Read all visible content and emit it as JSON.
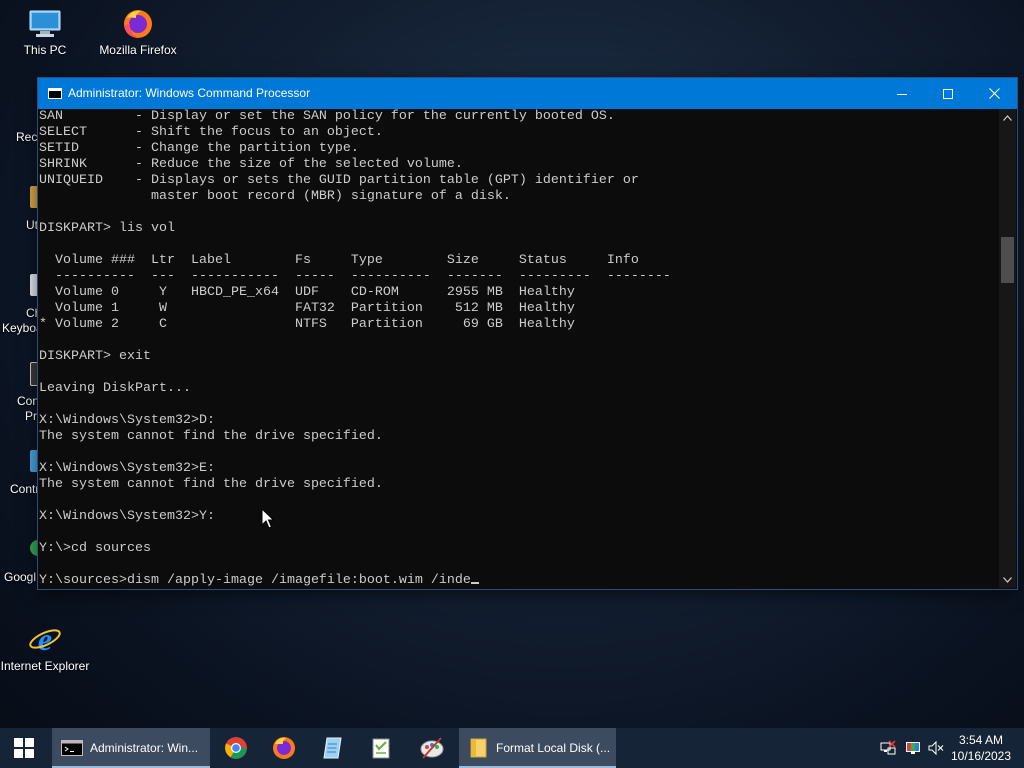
{
  "desktop": {
    "icons": [
      {
        "label": "This PC"
      },
      {
        "label": "Mozilla Firefox"
      },
      {
        "label": "Internet Explorer"
      }
    ],
    "partial_labels": [
      "Recy",
      "Ut",
      "Ch",
      "Keyboa",
      "Con",
      "Pr",
      "Contr",
      "Googl"
    ]
  },
  "window": {
    "title": "Administrator: Windows Command Processor",
    "console_lines": [
      "SAN         - Display or set the SAN policy for the currently booted OS.",
      "SELECT      - Shift the focus to an object.",
      "SETID       - Change the partition type.",
      "SHRINK      - Reduce the size of the selected volume.",
      "UNIQUEID    - Displays or sets the GUID partition table (GPT) identifier or",
      "              master boot record (MBR) signature of a disk.",
      "",
      "DISKPART> lis vol",
      "",
      "  Volume ###  Ltr  Label        Fs     Type        Size     Status     Info",
      "  ----------  ---  -----------  -----  ----------  -------  ---------  --------",
      "  Volume 0     Y   HBCD_PE_x64  UDF    CD-ROM      2955 MB  Healthy",
      "  Volume 1     W                FAT32  Partition    512 MB  Healthy",
      "* Volume 2     C                NTFS   Partition     69 GB  Healthy",
      "",
      "DISKPART> exit",
      "",
      "Leaving DiskPart...",
      "",
      "X:\\Windows\\System32>D:",
      "The system cannot find the drive specified.",
      "",
      "X:\\Windows\\System32>E:",
      "The system cannot find the drive specified.",
      "",
      "X:\\Windows\\System32>Y:",
      "",
      "Y:\\>cd sources",
      "",
      "Y:\\sources>dism /apply-image /imagefile:boot.wim /inde"
    ]
  },
  "taskbar": {
    "items": [
      {
        "label": "Administrator: Win..."
      },
      {
        "label": "Format Local Disk (..."
      }
    ],
    "pinned": [
      "chrome-icon",
      "firefox-icon",
      "notepad-icon",
      "notepad-plus-icon",
      "paint-icon"
    ],
    "clock": {
      "time": "3:54 AM",
      "date": "10/16/2023"
    }
  },
  "colors": {
    "titlebar": "#0078d7",
    "console_bg": "#0c0c0c",
    "console_text": "#cccccc",
    "taskbar": "#152436"
  }
}
